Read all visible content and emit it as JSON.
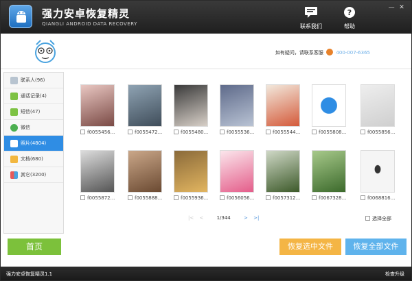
{
  "app": {
    "title": "强力安卓恢复精灵",
    "subtitle": "QIANGLI ANDROID DATA RECOVERY"
  },
  "header": {
    "contact_label": "联系我们",
    "help_label": "帮助"
  },
  "banner": {
    "support_text": "如有疑问，请联系客服",
    "phone": "400-007-6365"
  },
  "sidebar": {
    "items": [
      {
        "label": "联系人(96)",
        "color": "#b8c4d0"
      },
      {
        "label": "通话记录(4)",
        "color": "#7dc243"
      },
      {
        "label": "短信(47)",
        "color": "#7dc243"
      },
      {
        "label": "微信",
        "color": "#4caf50"
      },
      {
        "label": "照片(4804)",
        "color": "#5b95cf"
      },
      {
        "label": "文档(680)",
        "color": "#f2b73f"
      },
      {
        "label": "其它(3200)",
        "color": "#e65a5a"
      }
    ],
    "active_index": 4
  },
  "gallery": {
    "items": [
      {
        "label": "f0055456...",
        "c1": "#e9c7c2",
        "c2": "#7a4a45"
      },
      {
        "label": "f0055472...",
        "c1": "#8fa3b3",
        "c2": "#3f4d5a"
      },
      {
        "label": "f0055480...",
        "c1": "#3a3a3a",
        "c2": "#d8d0c8"
      },
      {
        "label": "f0055536...",
        "c1": "#5e6a8a",
        "c2": "#b9c3d4"
      },
      {
        "label": "f0055544...",
        "c1": "#f2e8dc",
        "c2": "#d45a3a"
      },
      {
        "label": "f0055808...",
        "c1": "#ffffff",
        "c2": "#2f8de4"
      },
      {
        "label": "f0055856...",
        "c1": "#eeeeee",
        "c2": "#777777"
      },
      {
        "label": "f0055872...",
        "c1": "#dcdcdc",
        "c2": "#222222"
      },
      {
        "label": "f0055888...",
        "c1": "#caa789",
        "c2": "#6b4a32"
      },
      {
        "label": "f0055936...",
        "c1": "#8a6a3a",
        "c2": "#e2b560"
      },
      {
        "label": "f0056056...",
        "c1": "#fbe6ec",
        "c2": "#e45d8a"
      },
      {
        "label": "f0057312...",
        "c1": "#cfd8c6",
        "c2": "#3d5a2a"
      },
      {
        "label": "f0067328...",
        "c1": "#6a9a4a",
        "c2": "#3c6a2c"
      },
      {
        "label": "f0068816...",
        "c1": "#f5f5f5",
        "c2": "#333333"
      }
    ]
  },
  "pager": {
    "first": "|<",
    "prev": "<",
    "page_text": "1/344",
    "next": ">",
    "last": ">|"
  },
  "select_all_label": "选择全部",
  "buttons": {
    "home": "首页",
    "recover_selected": "恢复选中文件",
    "recover_all": "恢复全部文件"
  },
  "status": {
    "version": "强力安卓恢复精灵1.1",
    "update": "检查升级"
  },
  "colors": {
    "accent": "#2f8de4",
    "home_btn": "#7cc13b",
    "recover_selected_btn": "#f4b545",
    "recover_all_btn": "#5fb3ec"
  }
}
